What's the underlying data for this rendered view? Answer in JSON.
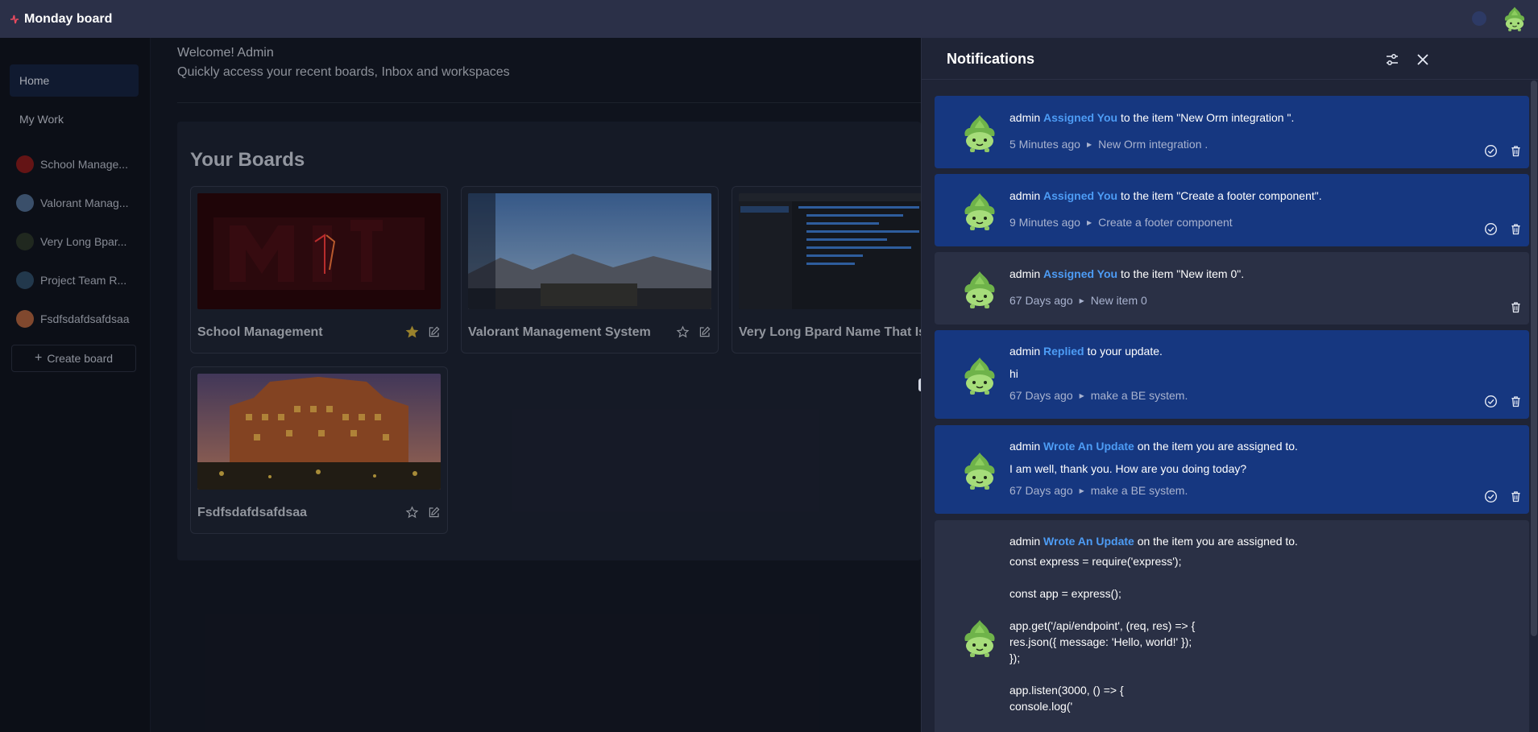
{
  "app": {
    "title": "Monday board"
  },
  "sidebar": {
    "nav": [
      {
        "label": "Home",
        "active": true
      },
      {
        "label": "My Work",
        "active": false
      }
    ],
    "workspaces": [
      {
        "label": "School Manage...",
        "color": "#8a1a1a"
      },
      {
        "label": "Valorant Manag...",
        "color": "#4f6b8f"
      },
      {
        "label": "Very Long Bpar...",
        "color": "#2c3527"
      },
      {
        "label": "Project Team R...",
        "color": "#2e4b66"
      },
      {
        "label": "Fsdfsdafdsafdsaa",
        "color": "#b0623c"
      }
    ],
    "create_board": "Create board"
  },
  "main": {
    "welcome": "Welcome! Admin",
    "subtitle": "Quickly access your recent boards, Inbox and workspaces",
    "boards_title": "Your Boards",
    "boards": [
      {
        "name": "School Management",
        "starred": true
      },
      {
        "name": "Valorant Management System",
        "starred": false
      },
      {
        "name": "Very Long Bpard Name That Is",
        "starred": false
      },
      {
        "name": "Fsdfsdafdsafdsaa",
        "starred": false
      }
    ]
  },
  "notifications": {
    "title": "Notifications",
    "items": [
      {
        "user": "admin",
        "action": "Assigned You",
        "rest": "to the item \"New Orm integration \".",
        "time": "5 Minutes ago",
        "item": "New Orm integration .",
        "unread": true
      },
      {
        "user": "admin",
        "action": "Assigned You",
        "rest": "to the item \"Create a footer component\".",
        "time": "9 Minutes ago",
        "item": "Create a footer component",
        "unread": true
      },
      {
        "user": "admin",
        "action": "Assigned You",
        "rest": "to the item \"New item 0\".",
        "time": "67 Days ago",
        "item": "New item 0",
        "unread": false
      },
      {
        "user": "admin",
        "action": "Replied",
        "rest": "to your update.",
        "body": "hi",
        "time": "67 Days ago",
        "item": "make a BE system.",
        "unread": true
      },
      {
        "user": "admin",
        "action": "Wrote An Update",
        "rest": "on the item you are assigned to.",
        "body": "I am well, thank you. How are you doing today?",
        "time": "67 Days ago",
        "item": "make a BE system.",
        "unread": true
      },
      {
        "user": "admin",
        "action": "Wrote An Update",
        "rest": "on the item you are assigned to.",
        "code": [
          "const express = require('express');",
          "",
          "const app = express();",
          "",
          "app.get('/api/endpoint', (req, res) => {",
          "res.json({ message: 'Hello, world!' });",
          "});",
          "",
          "app.listen(3000, () => {",
          "console.log('"
        ],
        "unread": false
      }
    ]
  },
  "colors": {
    "accent": "#4d9cf5",
    "unread_bg": "#163780",
    "read_bg": "#2a3045",
    "topbar": "#2b3048",
    "star": "#d4b23a"
  }
}
